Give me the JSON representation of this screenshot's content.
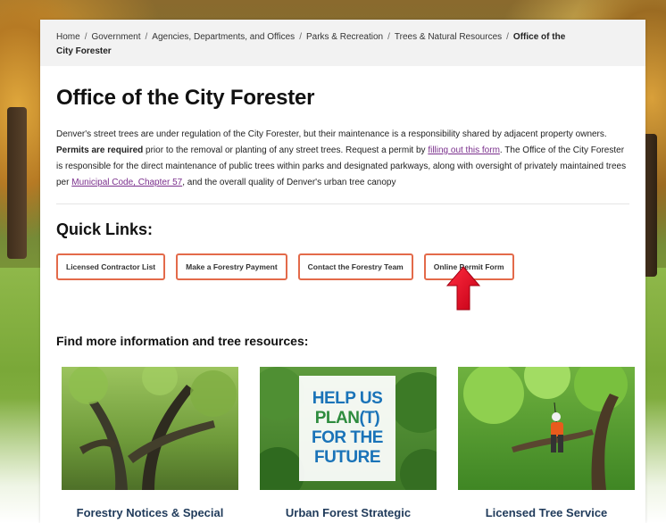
{
  "breadcrumb": {
    "items": [
      "Home",
      "Government",
      "Agencies, Departments, and Offices",
      "Parks & Recreation",
      "Trees & Natural Resources"
    ],
    "separator": "/",
    "current_line1": "Office of the",
    "current_line2": "City Forester"
  },
  "page": {
    "title": "Office of the City Forester"
  },
  "intro": {
    "part1": "Denver's street trees are under regulation of the City Forester, but their maintenance is a responsibility shared by adjacent property owners. ",
    "bold": "Permits are required",
    "part2": " prior to the removal or planting of any street trees. Request a permit by ",
    "link1": "filling out this form",
    "part3": ". The Office of the City Forester is responsible for the direct maintenance of public trees within parks and designated parkways, along with oversight of privately maintained trees per ",
    "link2": "Municipal Code, Chapter 57",
    "part4": ", and the overall quality of Denver's urban tree canopy"
  },
  "quick_links": {
    "title": "Quick Links:",
    "buttons": [
      "Licensed Contractor List",
      "Make a Forestry Payment",
      "Contact the Forestry Team",
      "Online Permit Form"
    ]
  },
  "resources": {
    "title": "Find more information and tree resources:",
    "tiles": [
      {
        "label": "Forestry Notices & Special"
      },
      {
        "label": "Urban Forest Strategic",
        "poster": [
          "HELP US",
          "PLAN",
          "(T)",
          "FOR THE",
          "FUTURE"
        ]
      },
      {
        "label": "Licensed Tree Service"
      }
    ]
  },
  "colors": {
    "button_border": "#e36a4a",
    "link": "#7a2f8c",
    "arrow": "#e8102a",
    "tile_label": "#1f3a5a"
  }
}
